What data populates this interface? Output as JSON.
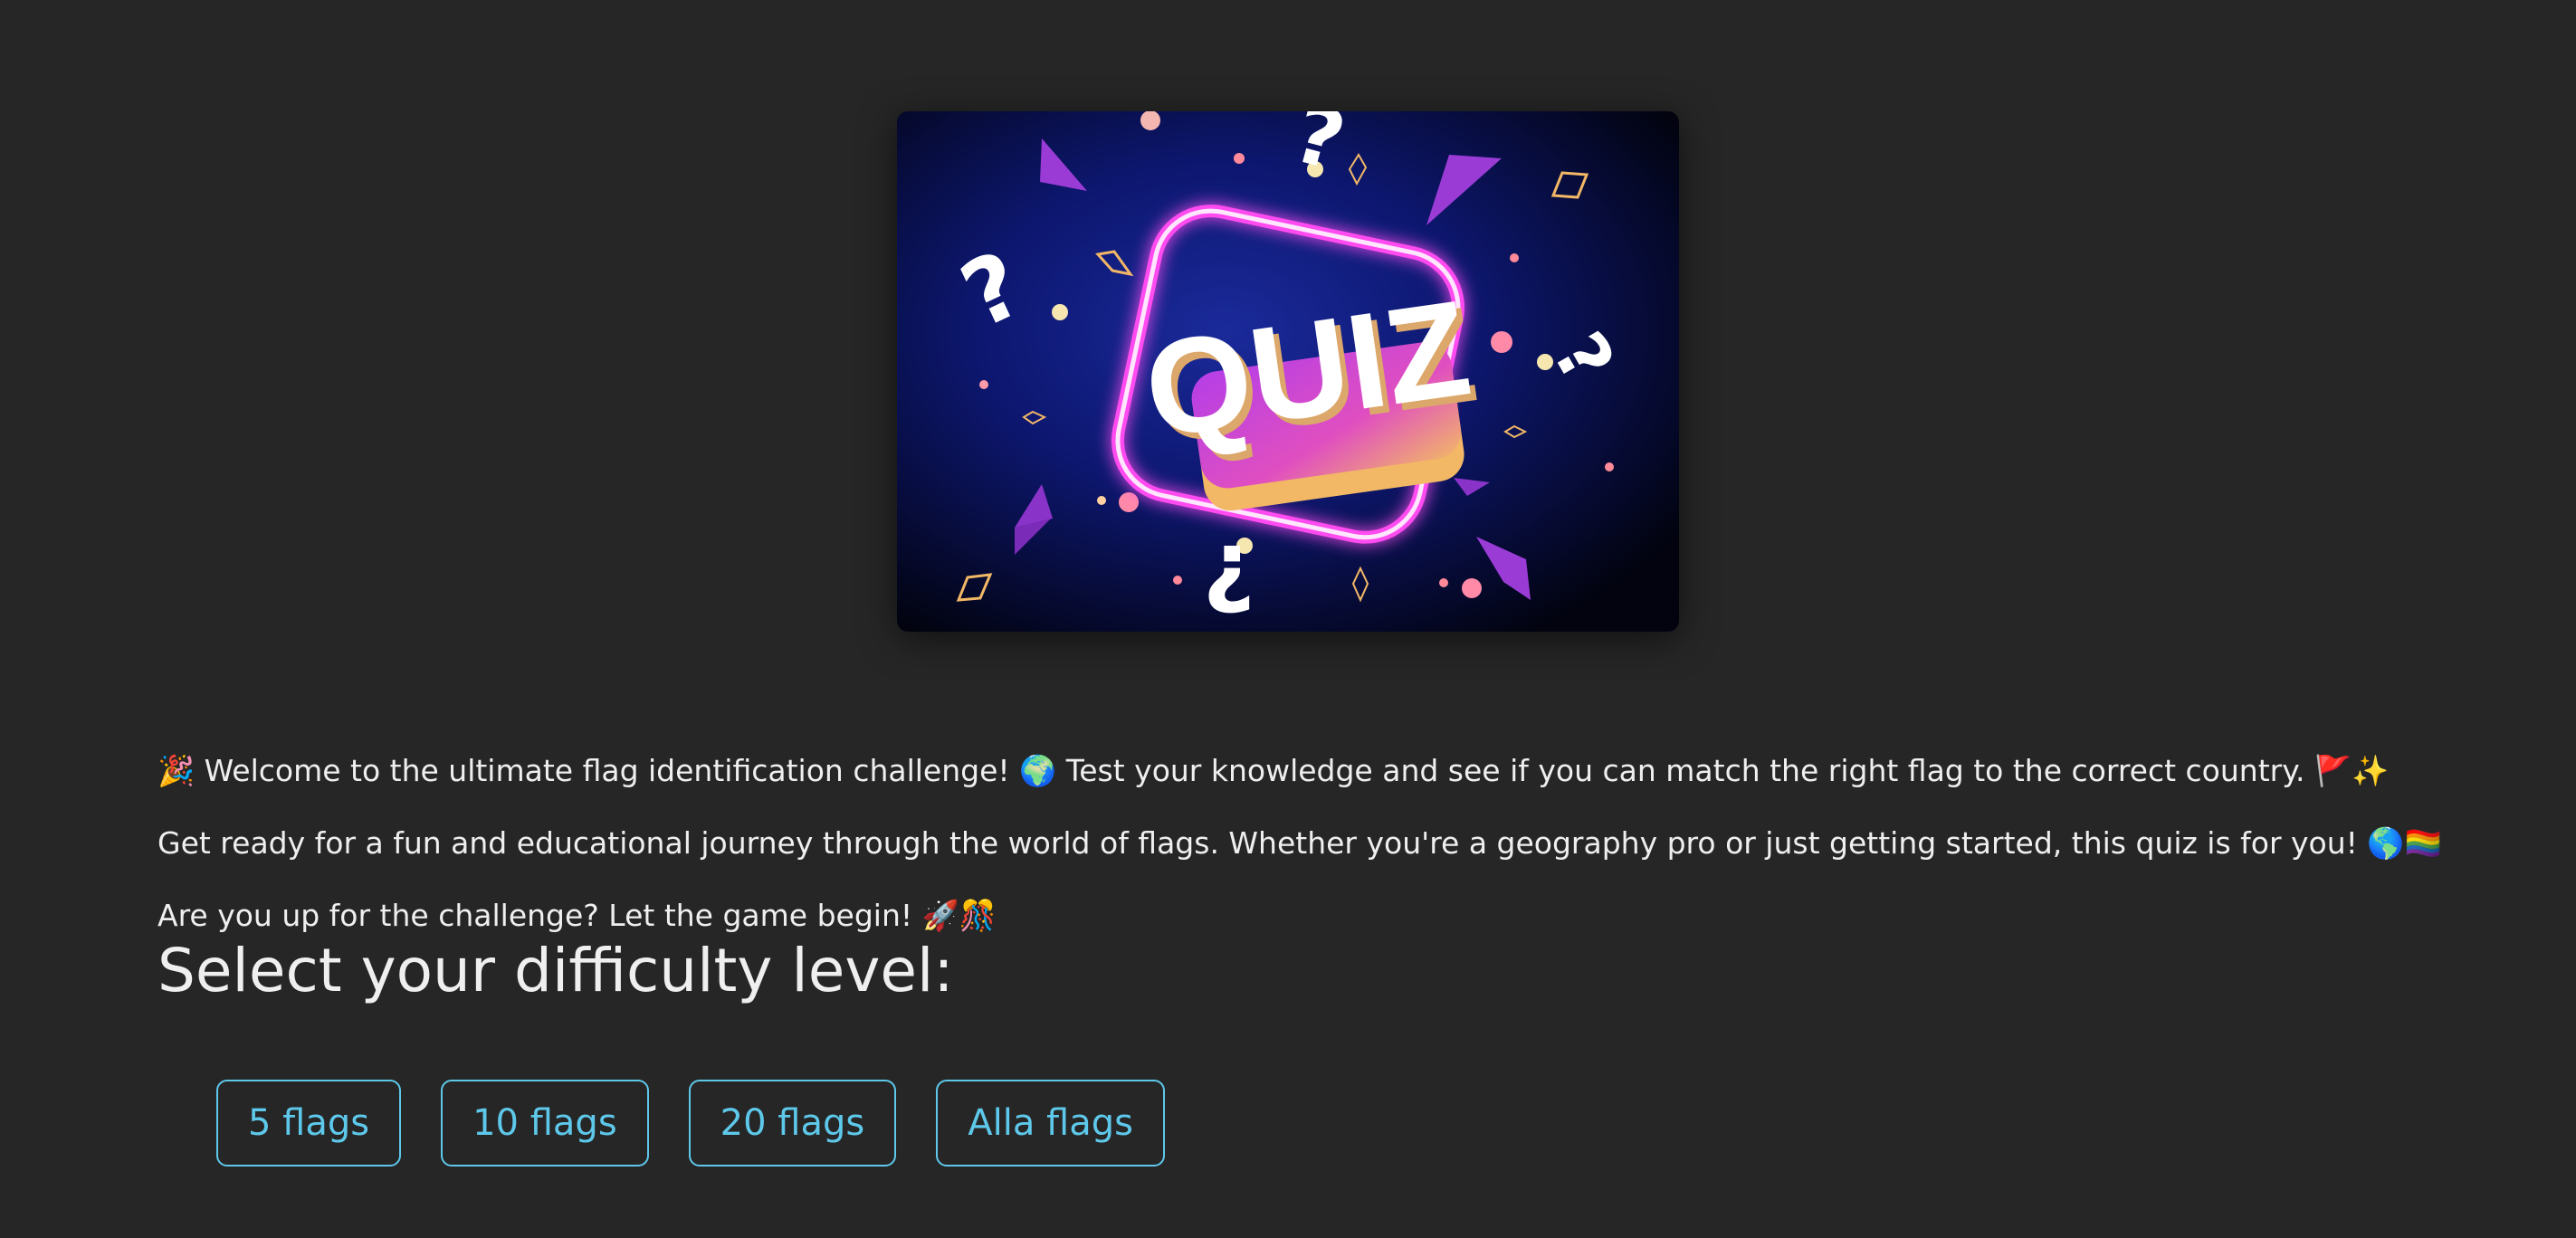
{
  "hero": {
    "logo_text": "QUIZ"
  },
  "intro": {
    "p1": "🎉 Welcome to the ultimate flag identification challenge! 🌍 Test your knowledge and see if you can match the right flag to the correct country. 🚩✨",
    "p2": "Get ready for a fun and educational journey through the world of flags. Whether you're a geography pro or just getting started, this quiz is for you! 🌎🏳️‍🌈",
    "p3": "Are you up for the challenge? Let the game begin! 🚀🎊"
  },
  "difficulty": {
    "heading": "Select your difficulty level:",
    "options": [
      "5 flags",
      "10 flags",
      "20 flags",
      "Alla flags"
    ]
  },
  "colors": {
    "background": "#262626",
    "accent": "#5ec8ea",
    "text": "#efefef"
  }
}
